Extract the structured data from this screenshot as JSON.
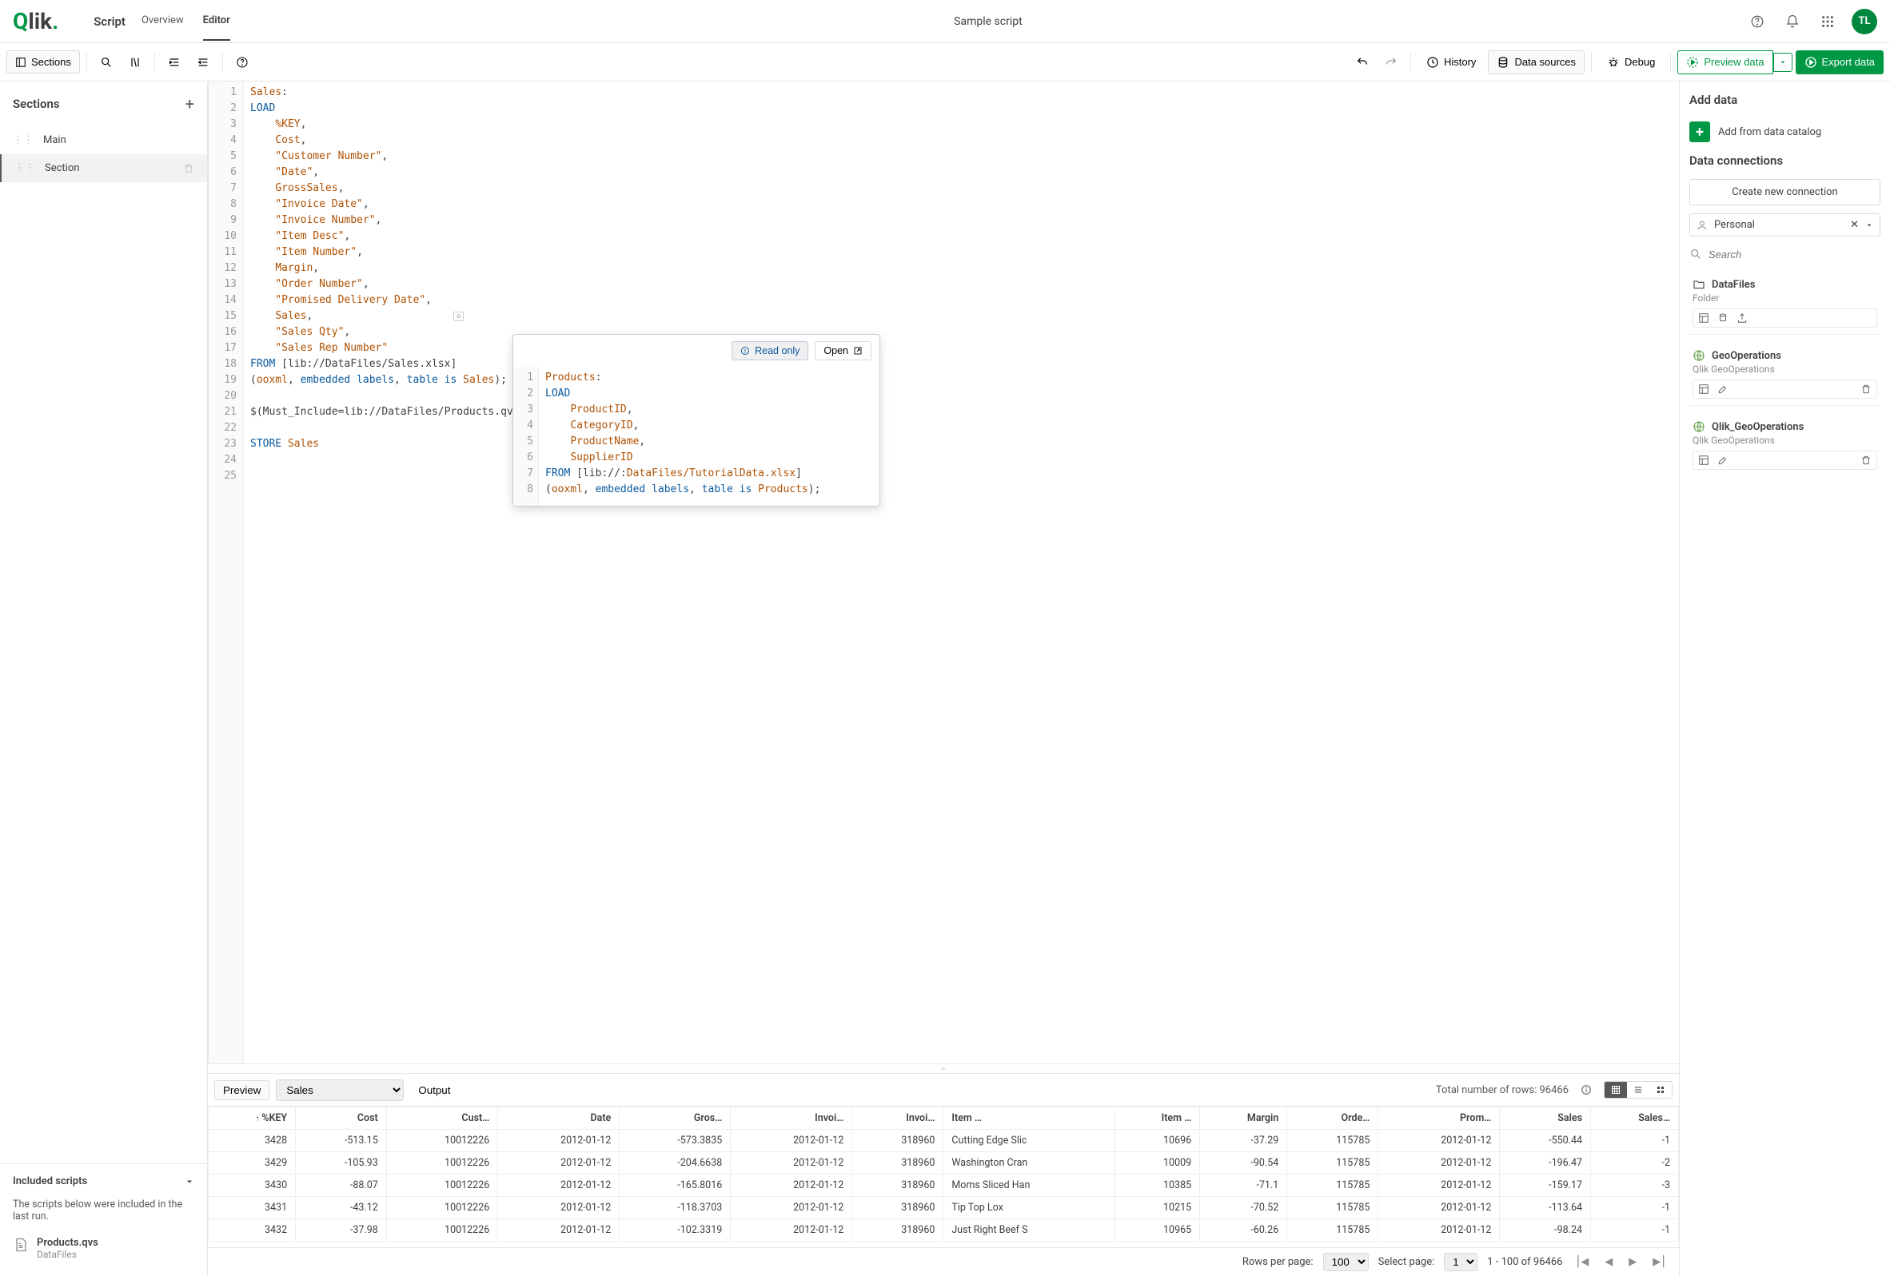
{
  "header": {
    "logo": "Qlik",
    "app_label": "Script",
    "tabs": {
      "overview": "Overview",
      "editor": "Editor"
    },
    "title": "Sample script",
    "avatar": "TL"
  },
  "toolbar": {
    "sections": "Sections",
    "history": "History",
    "data_sources": "Data sources",
    "debug": "Debug",
    "preview": "Preview data",
    "export": "Export data"
  },
  "sections_panel": {
    "title": "Sections",
    "items": [
      {
        "label": "Main",
        "active": false
      },
      {
        "label": "Section",
        "active": true
      }
    ],
    "included_title": "Included scripts",
    "included_sub": "The scripts below were included in the last run.",
    "included_items": [
      {
        "name": "Products.qvs",
        "source": "DataFiles"
      }
    ]
  },
  "editor": {
    "lines": [
      {
        "n": 1,
        "tokens": [
          [
            "tbl",
            "Sales"
          ],
          [
            "punc",
            ":"
          ]
        ]
      },
      {
        "n": 2,
        "tokens": [
          [
            "kw",
            "LOAD"
          ]
        ]
      },
      {
        "n": 3,
        "tokens": [
          [
            "punc",
            "    "
          ],
          [
            "fld",
            "%KEY"
          ],
          [
            "punc",
            ","
          ]
        ]
      },
      {
        "n": 4,
        "tokens": [
          [
            "punc",
            "    "
          ],
          [
            "fld",
            "Cost"
          ],
          [
            "punc",
            ","
          ]
        ]
      },
      {
        "n": 5,
        "tokens": [
          [
            "punc",
            "    "
          ],
          [
            "str",
            "\"Customer Number\""
          ],
          [
            "punc",
            ","
          ]
        ]
      },
      {
        "n": 6,
        "tokens": [
          [
            "punc",
            "    "
          ],
          [
            "str",
            "\"Date\""
          ],
          [
            "punc",
            ","
          ]
        ]
      },
      {
        "n": 7,
        "tokens": [
          [
            "punc",
            "    "
          ],
          [
            "fld",
            "GrossSales"
          ],
          [
            "punc",
            ","
          ]
        ]
      },
      {
        "n": 8,
        "tokens": [
          [
            "punc",
            "    "
          ],
          [
            "str",
            "\"Invoice Date\""
          ],
          [
            "punc",
            ","
          ]
        ]
      },
      {
        "n": 9,
        "tokens": [
          [
            "punc",
            "    "
          ],
          [
            "str",
            "\"Invoice Number\""
          ],
          [
            "punc",
            ","
          ]
        ]
      },
      {
        "n": 10,
        "tokens": [
          [
            "punc",
            "    "
          ],
          [
            "str",
            "\"Item Desc\""
          ],
          [
            "punc",
            ","
          ]
        ]
      },
      {
        "n": 11,
        "tokens": [
          [
            "punc",
            "    "
          ],
          [
            "str",
            "\"Item Number\""
          ],
          [
            "punc",
            ","
          ]
        ]
      },
      {
        "n": 12,
        "tokens": [
          [
            "punc",
            "    "
          ],
          [
            "fld",
            "Margin"
          ],
          [
            "punc",
            ","
          ]
        ]
      },
      {
        "n": 13,
        "tokens": [
          [
            "punc",
            "    "
          ],
          [
            "str",
            "\"Order Number\""
          ],
          [
            "punc",
            ","
          ]
        ]
      },
      {
        "n": 14,
        "tokens": [
          [
            "punc",
            "    "
          ],
          [
            "str",
            "\"Promised Delivery Date\""
          ],
          [
            "punc",
            ","
          ]
        ]
      },
      {
        "n": 15,
        "tokens": [
          [
            "punc",
            "    "
          ],
          [
            "fld",
            "Sales"
          ],
          [
            "punc",
            ","
          ]
        ]
      },
      {
        "n": 16,
        "tokens": [
          [
            "punc",
            "    "
          ],
          [
            "str",
            "\"Sales Qty\""
          ],
          [
            "punc",
            ","
          ]
        ]
      },
      {
        "n": 17,
        "tokens": [
          [
            "punc",
            "    "
          ],
          [
            "str",
            "\"Sales Rep Number\""
          ]
        ]
      },
      {
        "n": 18,
        "tokens": [
          [
            "kw",
            "FROM"
          ],
          [
            "punc",
            " [lib://DataFiles/Sales.xlsx]"
          ]
        ]
      },
      {
        "n": 19,
        "tokens": [
          [
            "punc",
            "("
          ],
          [
            "lit",
            "ooxml"
          ],
          [
            "punc",
            ", "
          ],
          [
            "kw2",
            "embedded labels"
          ],
          [
            "punc",
            ", "
          ],
          [
            "kw2",
            "table is"
          ],
          [
            "punc",
            " "
          ],
          [
            "tbl",
            "Sales"
          ],
          [
            "punc",
            ");"
          ]
        ]
      },
      {
        "n": 20,
        "tokens": []
      },
      {
        "n": 21,
        "tokens": [
          [
            "punc",
            "$(Must_Include=lib://DataFiles/Products.qvs);"
          ]
        ]
      },
      {
        "n": 22,
        "tokens": []
      },
      {
        "n": 23,
        "tokens": [
          [
            "kw",
            "STORE"
          ],
          [
            "punc",
            " "
          ],
          [
            "tbl",
            "Sales"
          ]
        ]
      },
      {
        "n": 24,
        "tokens": []
      },
      {
        "n": 25,
        "tokens": []
      }
    ]
  },
  "popover": {
    "read_only": "Read only",
    "open": "Open",
    "lines": [
      {
        "n": 1,
        "tokens": [
          [
            "tbl",
            "Products"
          ],
          [
            "punc",
            ":"
          ]
        ]
      },
      {
        "n": 2,
        "tokens": [
          [
            "kw",
            "LOAD"
          ]
        ]
      },
      {
        "n": 3,
        "tokens": [
          [
            "punc",
            "    "
          ],
          [
            "fld",
            "ProductID"
          ],
          [
            "punc",
            ","
          ]
        ]
      },
      {
        "n": 4,
        "tokens": [
          [
            "punc",
            "    "
          ],
          [
            "fld",
            "CategoryID"
          ],
          [
            "punc",
            ","
          ]
        ]
      },
      {
        "n": 5,
        "tokens": [
          [
            "punc",
            "    "
          ],
          [
            "fld",
            "ProductName"
          ],
          [
            "punc",
            ","
          ]
        ]
      },
      {
        "n": 6,
        "tokens": [
          [
            "punc",
            "    "
          ],
          [
            "fld",
            "SupplierID"
          ]
        ]
      },
      {
        "n": 7,
        "tokens": [
          [
            "kw",
            "FROM"
          ],
          [
            "punc",
            " [lib://:"
          ],
          [
            "fld",
            "DataFiles/TutorialData.xlsx"
          ],
          [
            "punc",
            "]"
          ]
        ]
      },
      {
        "n": 8,
        "tokens": [
          [
            "punc",
            "("
          ],
          [
            "lit",
            "ooxml"
          ],
          [
            "punc",
            ", "
          ],
          [
            "kw2",
            "embedded labels"
          ],
          [
            "punc",
            ", "
          ],
          [
            "kw2",
            "table is"
          ],
          [
            "punc",
            " "
          ],
          [
            "tbl",
            "Products"
          ],
          [
            "punc",
            ");"
          ]
        ]
      }
    ]
  },
  "right_panel": {
    "add_data": "Add data",
    "add_catalog": "Add from data catalog",
    "data_connections": "Data connections",
    "create_connection": "Create new connection",
    "selected_connection": "Personal",
    "search_placeholder": "Search",
    "datafiles": {
      "name": "DataFiles",
      "type": "Folder"
    },
    "geo1": {
      "name": "GeoOperations",
      "sub": "Qlik GeoOperations"
    },
    "geo2": {
      "name": "Qlik_GeoOperations",
      "sub": "Qlik GeoOperations"
    }
  },
  "preview": {
    "preview_tab": "Preview",
    "output_tab": "Output",
    "table_select": "Sales",
    "total_label": "Total number of rows:",
    "total_value": "96466",
    "columns": [
      "%KEY",
      "Cost",
      "Cust…",
      "Date",
      "Gros…",
      "Invoi…",
      "Invoi…",
      "Item …",
      "Item …",
      "Margin",
      "Orde…",
      "Prom…",
      "Sales",
      "Sales…"
    ],
    "rows": [
      [
        "3428",
        "-513.15",
        "10012226",
        "2012-01-12",
        "-573.3835",
        "2012-01-12",
        "318960",
        "Cutting Edge Slic",
        "10696",
        "-37.29",
        "115785",
        "2012-01-12",
        "-550.44",
        "-1"
      ],
      [
        "3429",
        "-105.93",
        "10012226",
        "2012-01-12",
        "-204.6638",
        "2012-01-12",
        "318960",
        "Washington Cran",
        "10009",
        "-90.54",
        "115785",
        "2012-01-12",
        "-196.47",
        "-2"
      ],
      [
        "3430",
        "-88.07",
        "10012226",
        "2012-01-12",
        "-165.8016",
        "2012-01-12",
        "318960",
        "Moms Sliced Han",
        "10385",
        "-71.1",
        "115785",
        "2012-01-12",
        "-159.17",
        "-3"
      ],
      [
        "3431",
        "-43.12",
        "10012226",
        "2012-01-12",
        "-118.3703",
        "2012-01-12",
        "318960",
        "Tip Top Lox",
        "10215",
        "-70.52",
        "115785",
        "2012-01-12",
        "-113.64",
        "-1"
      ],
      [
        "3432",
        "-37.98",
        "10012226",
        "2012-01-12",
        "-102.3319",
        "2012-01-12",
        "318960",
        "Just Right Beef S",
        "10965",
        "-60.26",
        "115785",
        "2012-01-12",
        "-98.24",
        "-1"
      ]
    ],
    "footer": {
      "rows_per_page_label": "Rows per page:",
      "rows_per_page": "100",
      "select_page_label": "Select page:",
      "select_page": "1",
      "range": "1 - 100 of 96466"
    }
  }
}
